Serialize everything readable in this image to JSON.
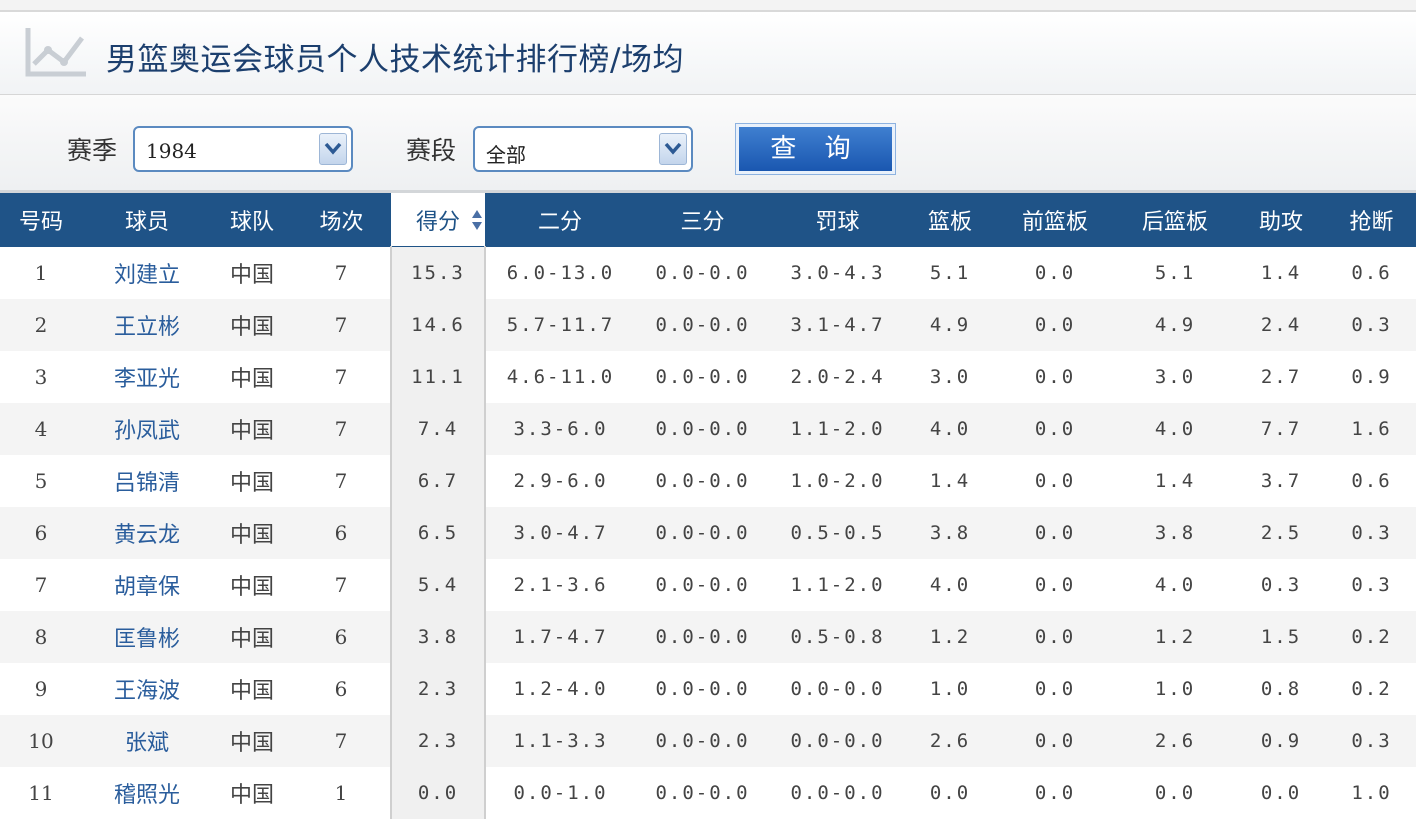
{
  "page": {
    "title": "男篮奥运会球员个人技术统计排行榜/场均"
  },
  "filters": {
    "season_label": "赛季",
    "season_value": "1984",
    "stage_label": "赛段",
    "stage_value": "全部",
    "query_label": "查 询"
  },
  "table": {
    "headers": [
      "号码",
      "球员",
      "球队",
      "场次",
      "得分",
      "二分",
      "三分",
      "罚球",
      "篮板",
      "前篮板",
      "后篮板",
      "助攻",
      "抢断"
    ],
    "sorted_column": "得分",
    "rows": [
      [
        "1",
        "刘建立",
        "中国",
        "7",
        "15.3",
        "6.0-13.0",
        "0.0-0.0",
        "3.0-4.3",
        "5.1",
        "0.0",
        "5.1",
        "1.4",
        "0.6"
      ],
      [
        "2",
        "王立彬",
        "中国",
        "7",
        "14.6",
        "5.7-11.7",
        "0.0-0.0",
        "3.1-4.7",
        "4.9",
        "0.0",
        "4.9",
        "2.4",
        "0.3"
      ],
      [
        "3",
        "李亚光",
        "中国",
        "7",
        "11.1",
        "4.6-11.0",
        "0.0-0.0",
        "2.0-2.4",
        "3.0",
        "0.0",
        "3.0",
        "2.7",
        "0.9"
      ],
      [
        "4",
        "孙凤武",
        "中国",
        "7",
        "7.4",
        "3.3-6.0",
        "0.0-0.0",
        "1.1-2.0",
        "4.0",
        "0.0",
        "4.0",
        "7.7",
        "1.6"
      ],
      [
        "5",
        "吕锦清",
        "中国",
        "7",
        "6.7",
        "2.9-6.0",
        "0.0-0.0",
        "1.0-2.0",
        "1.4",
        "0.0",
        "1.4",
        "3.7",
        "0.6"
      ],
      [
        "6",
        "黄云龙",
        "中国",
        "6",
        "6.5",
        "3.0-4.7",
        "0.0-0.0",
        "0.5-0.5",
        "3.8",
        "0.0",
        "3.8",
        "2.5",
        "0.3"
      ],
      [
        "7",
        "胡章保",
        "中国",
        "7",
        "5.4",
        "2.1-3.6",
        "0.0-0.0",
        "1.1-2.0",
        "4.0",
        "0.0",
        "4.0",
        "0.3",
        "0.3"
      ],
      [
        "8",
        "匡鲁彬",
        "中国",
        "6",
        "3.8",
        "1.7-4.7",
        "0.0-0.0",
        "0.5-0.8",
        "1.2",
        "0.0",
        "1.2",
        "1.5",
        "0.2"
      ],
      [
        "9",
        "王海波",
        "中国",
        "6",
        "2.3",
        "1.2-4.0",
        "0.0-0.0",
        "0.0-0.0",
        "1.0",
        "0.0",
        "1.0",
        "0.8",
        "0.2"
      ],
      [
        "10",
        "张斌",
        "中国",
        "7",
        "2.3",
        "1.1-3.3",
        "0.0-0.0",
        "0.0-0.0",
        "2.6",
        "0.0",
        "2.6",
        "0.9",
        "0.3"
      ],
      [
        "11",
        "稽照光",
        "中国",
        "1",
        "0.0",
        "0.0-1.0",
        "0.0-0.0",
        "0.0-0.0",
        "0.0",
        "0.0",
        "0.0",
        "0.0",
        "1.0"
      ]
    ]
  },
  "colors": {
    "header_bg": "#1f5387",
    "title_text": "#1c3f6e",
    "player_link": "#2a5d9c",
    "button": "#1a57b0"
  },
  "icons": {
    "title": "line-chart-icon",
    "dropdown": "chevron-down-icon",
    "sort": "sort-icon"
  }
}
